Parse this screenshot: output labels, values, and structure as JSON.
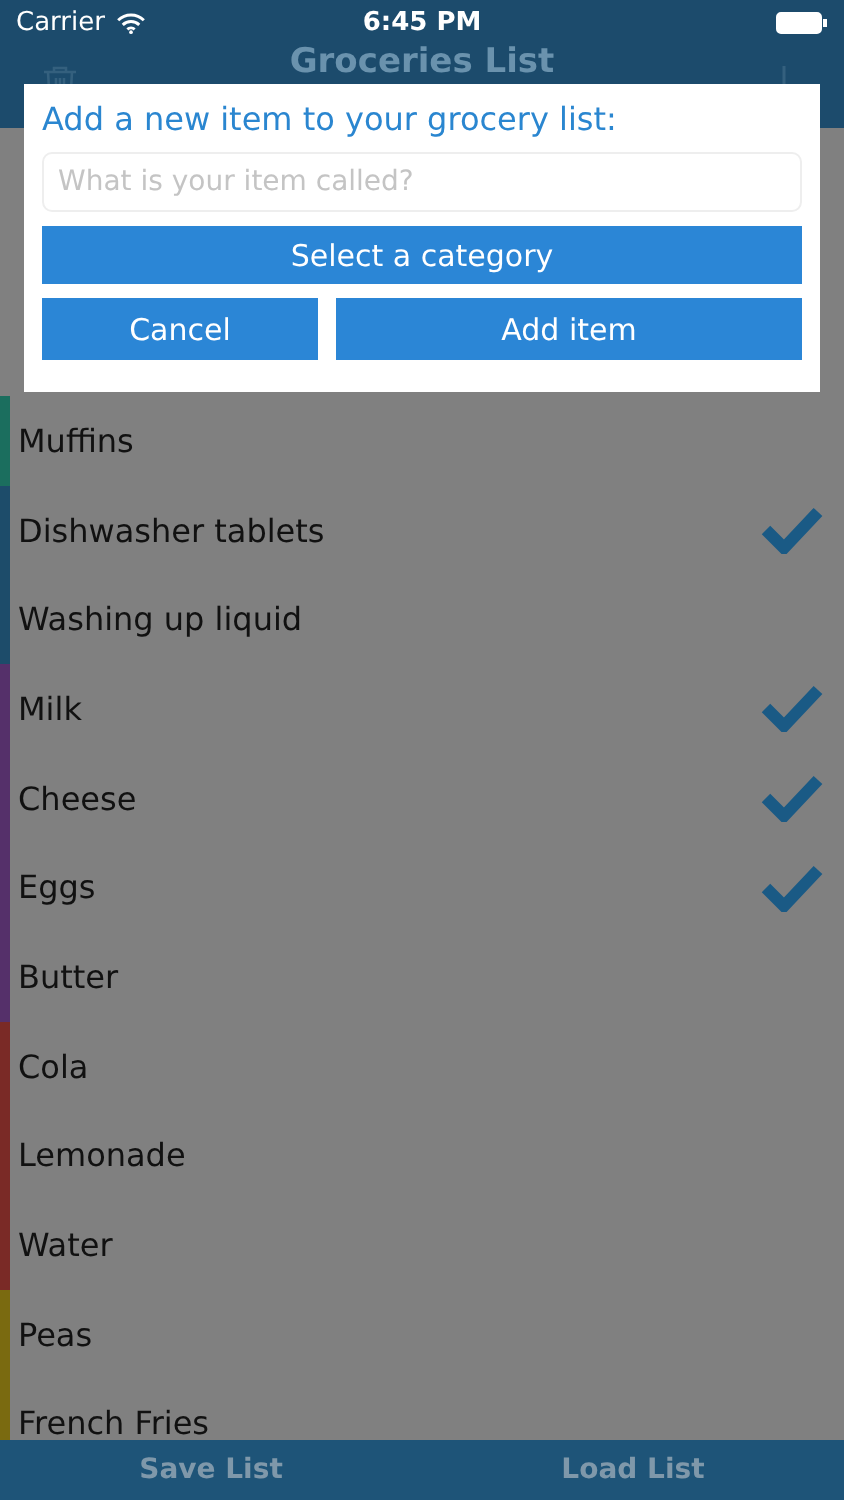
{
  "status_bar": {
    "carrier": "Carrier",
    "time": "6:45 PM"
  },
  "nav": {
    "title": "Groceries List"
  },
  "items": [
    {
      "name": "Muffins",
      "checked": false,
      "color": "#1b6e5e"
    },
    {
      "name": "Dishwasher tablets",
      "checked": true,
      "color": "#1d4c6a"
    },
    {
      "name": "Washing up liquid",
      "checked": false,
      "color": "#1d4c6a"
    },
    {
      "name": "Milk",
      "checked": true,
      "color": "#55306a"
    },
    {
      "name": "Cheese",
      "checked": true,
      "color": "#55306a"
    },
    {
      "name": "Eggs",
      "checked": true,
      "color": "#55306a"
    },
    {
      "name": "Butter",
      "checked": false,
      "color": "#55306a"
    },
    {
      "name": "Cola",
      "checked": false,
      "color": "#7a2a26"
    },
    {
      "name": "Lemonade",
      "checked": false,
      "color": "#7a2a26"
    },
    {
      "name": "Water",
      "checked": false,
      "color": "#7a2a26"
    },
    {
      "name": "Peas",
      "checked": false,
      "color": "#7a6a10"
    },
    {
      "name": "French Fries",
      "checked": false,
      "color": "#7a6a10"
    }
  ],
  "dialog": {
    "title": "Add a new item to your grocery list:",
    "placeholder": "What is your item called?",
    "category_button": "Select a category",
    "cancel": "Cancel",
    "add": "Add item"
  },
  "toolbar": [
    "Save List",
    "Load List"
  ]
}
